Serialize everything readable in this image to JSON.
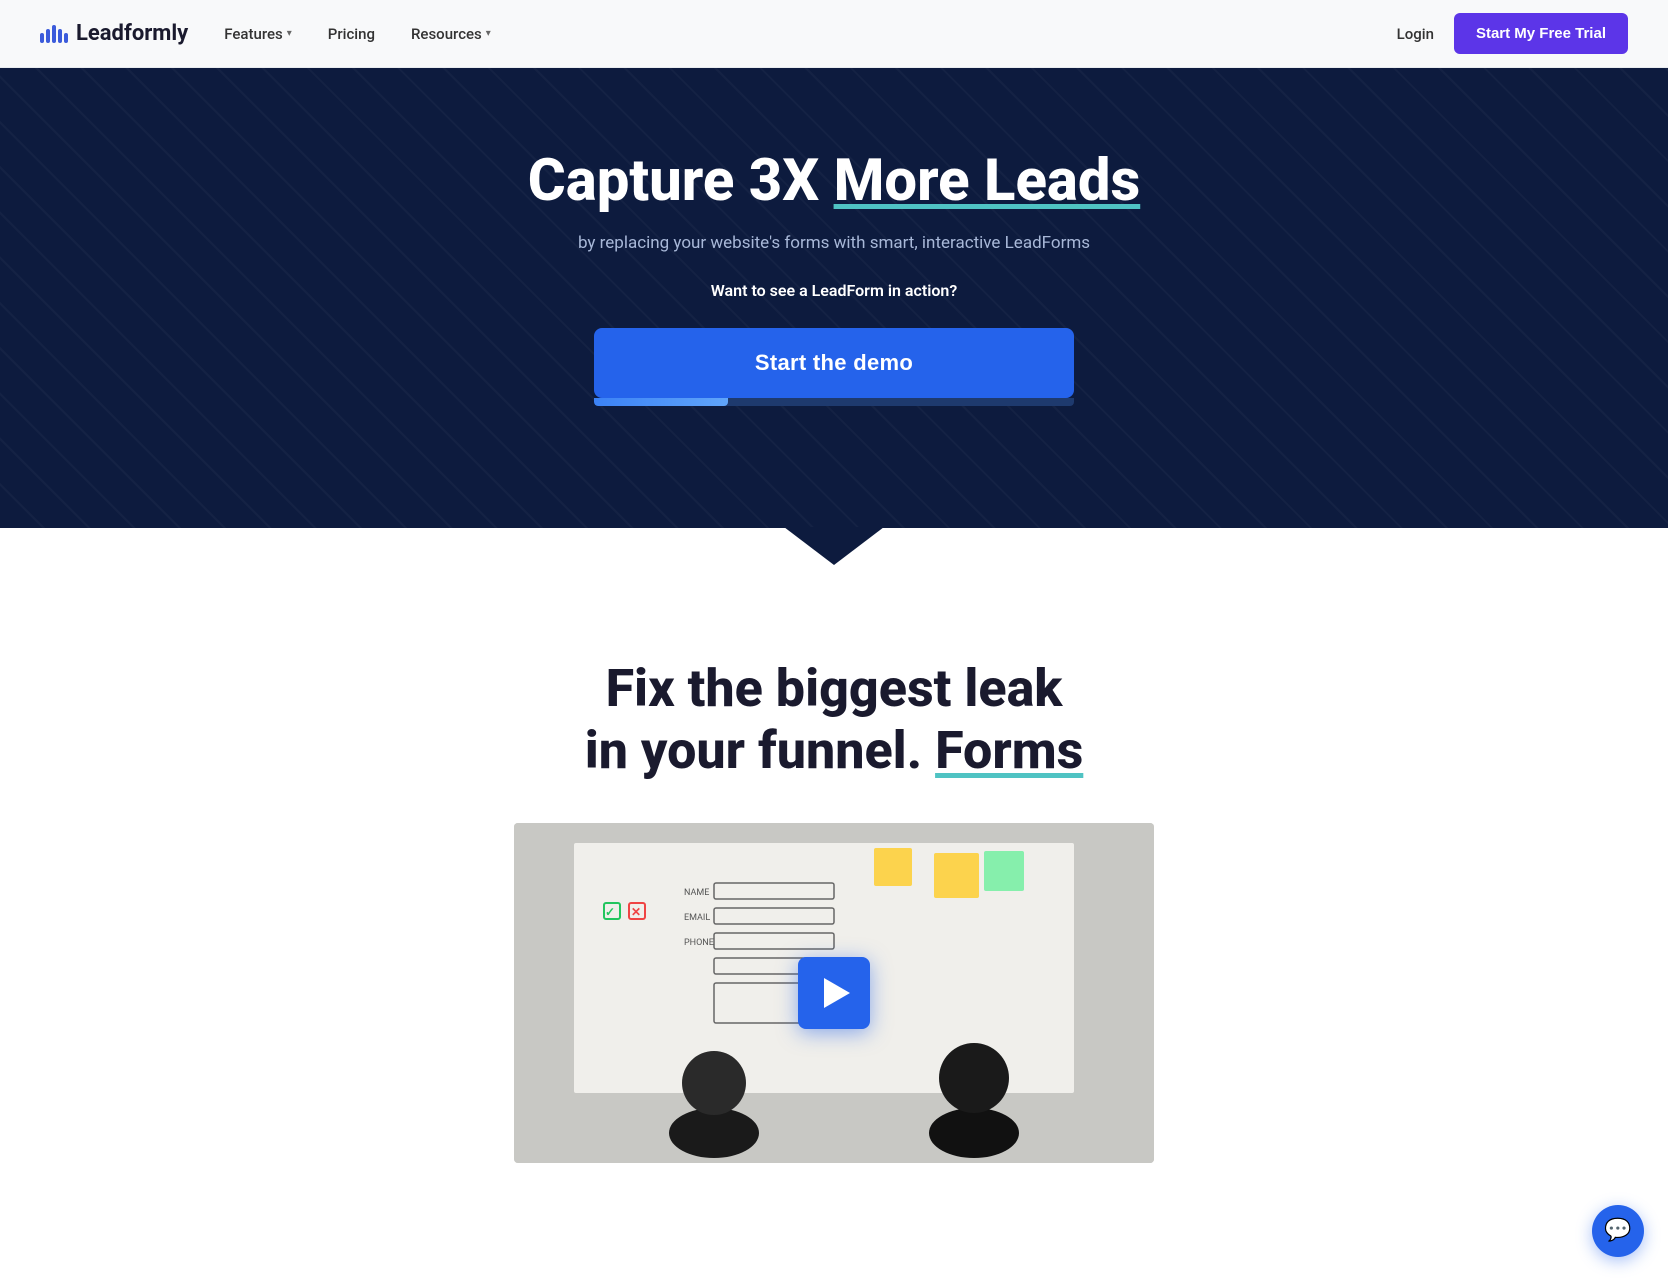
{
  "navbar": {
    "logo_text": "Leadformly",
    "features_label": "Features",
    "pricing_label": "Pricing",
    "resources_label": "Resources",
    "login_label": "Login",
    "cta_label": "Start My Free Trial"
  },
  "hero": {
    "title_part1": "Capture 3X ",
    "title_highlight": "More Leads",
    "subtitle": "by replacing your website's forms with smart, interactive LeadForms",
    "question": "Want to see a LeadForm in action?",
    "demo_button": "Start the demo",
    "progress_percent": 28
  },
  "section2": {
    "title_line1": "Fix the biggest leak",
    "title_line2": "in your funnel. ",
    "title_highlight": "Forms"
  },
  "video": {
    "play_label": "Play video"
  },
  "chat": {
    "icon_label": "Open chat"
  }
}
